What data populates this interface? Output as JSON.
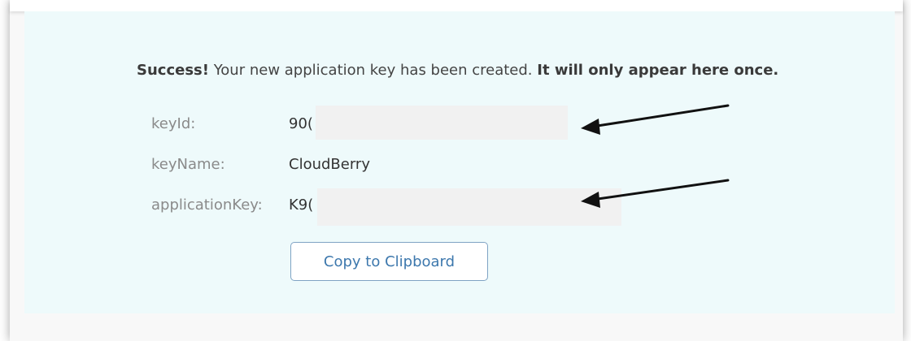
{
  "message": {
    "lead": "Success!",
    "body": " Your new application key has been created. ",
    "emphasis": "It will only appear here once."
  },
  "fields": [
    {
      "label": "keyId:",
      "value": "90("
    },
    {
      "label": "keyName:",
      "value": "CloudBerry"
    },
    {
      "label": "applicationKey:",
      "value": "K9("
    }
  ],
  "actions": {
    "copy_label": "Copy to Clipboard"
  },
  "icons": {
    "annotation": "arrow-left-icon"
  },
  "colors": {
    "panel_background": "#eefafb",
    "button_text": "#3d78ad",
    "button_border": "#7fa3c4",
    "label_text": "#8a8a8a"
  }
}
